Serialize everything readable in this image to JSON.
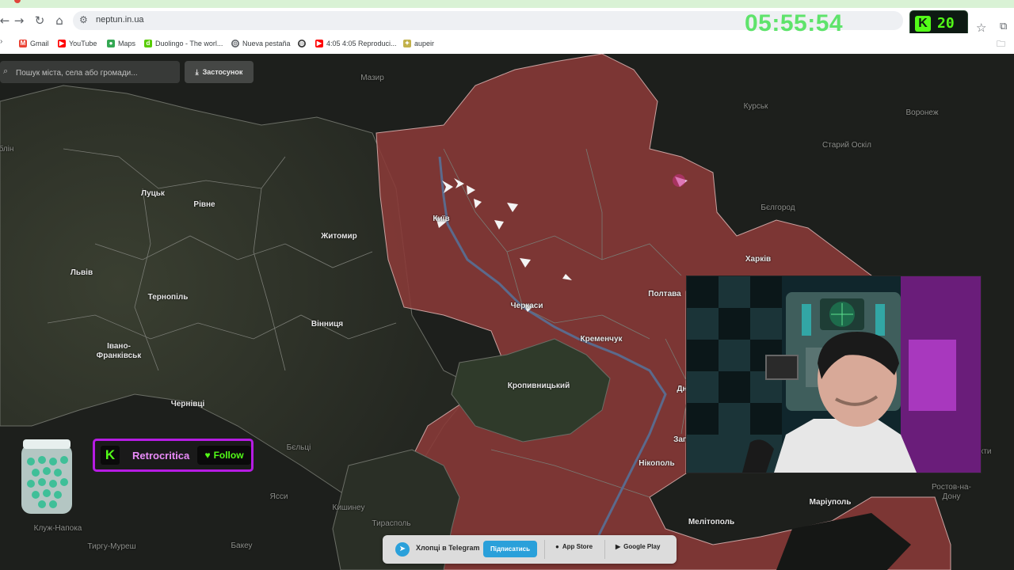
{
  "browser": {
    "url": "neptun.in.ua",
    "bookmarks": [
      {
        "label": "Gmail",
        "icon": "gmail-icon",
        "color": "#ea4335"
      },
      {
        "label": "YouTube",
        "icon": "youtube-icon",
        "color": "#ff0000"
      },
      {
        "label": "Maps",
        "icon": "maps-pin-icon",
        "color": "#34a853"
      },
      {
        "label": "Duolingo - The worl...",
        "icon": "duolingo-icon",
        "color": "#58cc02"
      },
      {
        "label": "Nueva pestaña",
        "icon": "chrome-icon",
        "color": "#5f6368"
      },
      {
        "label": "",
        "icon": "globe-icon",
        "color": "#333333"
      },
      {
        "label": "4:05 4:05 Reproduci...",
        "icon": "youtube-icon",
        "color": "#ff0000"
      },
      {
        "label": "aupeir",
        "icon": "aupeir-icon",
        "color": "#c2b14a"
      }
    ]
  },
  "stream": {
    "timer": "05:55:54",
    "kick_badge_count": "20",
    "kick_brand_color": "#53fc18",
    "channel_name": "Retrocritica",
    "follow_label": "Follow",
    "accent_color": "#b61ce3"
  },
  "map_ui": {
    "search_placeholder": "Пошук міста, села або громади...",
    "app_button_label": "Застосунок",
    "telegram_text": "Хлопці в Telegram",
    "subscribe_label": "Підписатись",
    "app_store_label": "App Store",
    "google_play_label": "Google Play",
    "alert_color": "#8a3a38"
  },
  "cities": {
    "mazir": "Мазир",
    "kursk": "Курськ",
    "voronezh": "Воронеж",
    "staryi_oskil": "Старий Оскіл",
    "blin": "блін",
    "lutsk": "Луцьк",
    "rivne": "Рівне",
    "zhytomyr": "Житомир",
    "kyiv": "Київ",
    "bilhorod": "Бєлгород",
    "kharkiv": "Харків",
    "lviv": "Львів",
    "ternopil": "Тернопіль",
    "vinnytsia": "Вінниця",
    "cherkasy": "Черкаси",
    "poltava": "Полтава",
    "kremenchuk": "Кременчук",
    "ivano_frankivsk": "Івано-Франківськ",
    "chernivtsi": "Чернівці",
    "kropyvnytskyi": "Кропивницький",
    "dnipro_partial": "Дн",
    "zaporizhzhia_partial": "Зап",
    "beltsy": "Бєльці",
    "yassy": "Ясси",
    "kishinev": "Кишинеу",
    "tiraspol": "Тирасполь",
    "nikopol": "Нікополь",
    "melitopol": "Мелітополь",
    "mariupol": "Маріуполь",
    "rostov": "Ростов-на-Дону",
    "khti_partial": "хти",
    "kluj": "Клуж-Напока",
    "tirgu": "Тиргу-Муреш",
    "bakeu": "Бакеу"
  }
}
